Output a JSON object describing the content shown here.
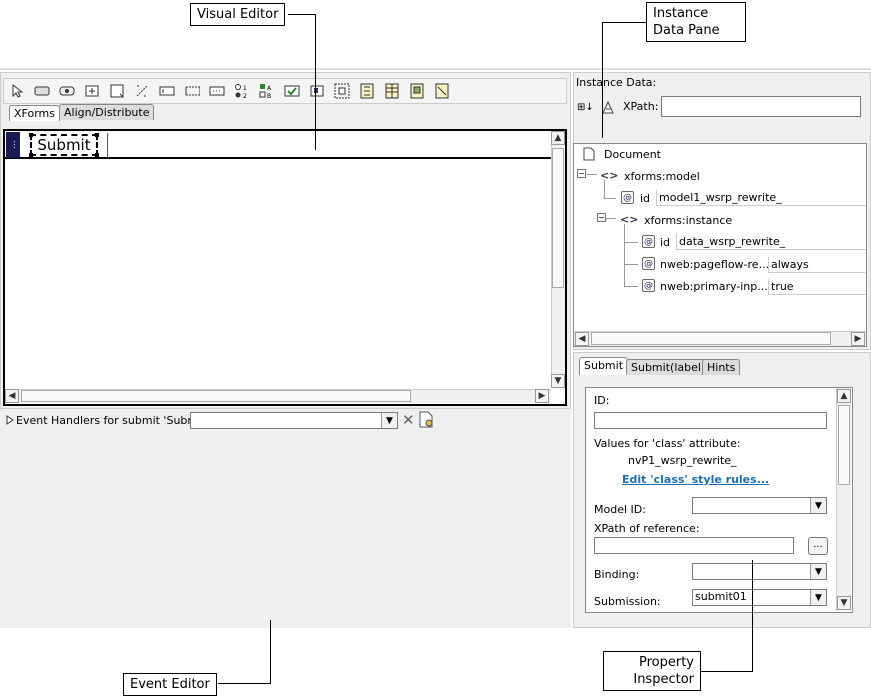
{
  "callouts": {
    "visual_editor": "Visual Editor",
    "instance_data_pane_1": "Instance",
    "instance_data_pane_2": "Data Pane",
    "event_editor": "Event Editor",
    "property_inspector_1": "Property",
    "property_inspector_2": "Inspector"
  },
  "palette_tabs": [
    "XForms",
    "Align/Distribute"
  ],
  "canvas": {
    "group_label": "...",
    "submit_button": "Submit"
  },
  "event_handlers": {
    "label": "Event Handlers for submit 'Submit'",
    "select_value": ""
  },
  "instance_data": {
    "title": "Instance Data:",
    "xpath_label": "XPath:",
    "xpath_value": "",
    "tree": {
      "document": "Document",
      "model": "xforms:model",
      "model_id_name": "id",
      "model_id_value": "model1_wsrp_rewrite_",
      "instance": "xforms:instance",
      "instance_id_name": "id",
      "instance_id_value": "data_wsrp_rewrite_",
      "pageflow_name": "nweb:pageflow-re...",
      "pageflow_value": "always",
      "primary_name": "nweb:primary-inp...",
      "primary_value": "true"
    }
  },
  "inspector": {
    "tabs": [
      "Submit",
      "Submit(label)",
      "Hints"
    ],
    "id_label": "ID:",
    "id_value": "",
    "class_label": "Values for 'class' attribute:",
    "class_value": "nvP1_wsrp_rewrite_",
    "edit_class_link": "Edit 'class' style rules...",
    "model_id_label": "Model ID:",
    "model_id_value": "",
    "xpath_ref_label": "XPath of reference:",
    "xpath_ref_value": "",
    "xpath_ref_button": "...",
    "binding_label": "Binding:",
    "binding_value": "",
    "submission_label": "Submission:",
    "submission_value": "submit01"
  },
  "colors": {
    "panel_gray": "#efefef",
    "link_blue": "#1f6fb2",
    "selection_navy": "#1a1a55",
    "cursor_red": "#cc2222"
  }
}
